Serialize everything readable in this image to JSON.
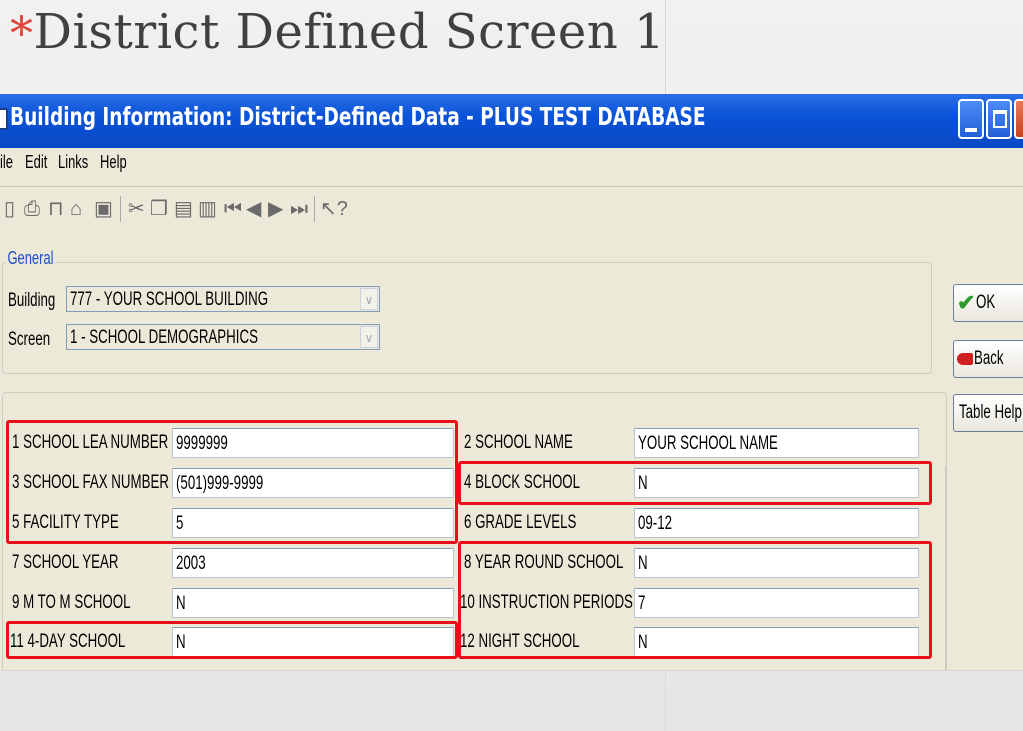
{
  "slide": {
    "bullet": "*",
    "title": "District Defined Screen 1"
  },
  "window": {
    "title": "Building Information: District-Defined Data - PLUS TEST DATABASE"
  },
  "menu": [
    {
      "label": "ile"
    },
    {
      "label": "Edit"
    },
    {
      "label": "Links"
    },
    {
      "label": "Help"
    }
  ],
  "toolbar_icons": [
    "new-icon",
    "print-icon",
    "delete-icon",
    "open-icon",
    "save-icon",
    "cut-icon",
    "copy-icon",
    "paste-icon",
    "clipboard-icon",
    "first-record-icon",
    "prev-record-icon",
    "next-record-icon",
    "last-record-icon",
    "help-pointer-icon"
  ],
  "general": {
    "group_label": "General",
    "building_label": "Building",
    "building_value": "777 - YOUR SCHOOL BUILDING",
    "screen_label": "Screen",
    "screen_value": "1 - SCHOOL DEMOGRAPHICS"
  },
  "buttons": {
    "ok": "OK",
    "back": "Back",
    "table_help": "Table Help"
  },
  "fields": [
    {
      "label": "1  SCHOOL LEA NUMBER",
      "value": "9999999"
    },
    {
      "label": "2  SCHOOL NAME",
      "value": "YOUR SCHOOL NAME"
    },
    {
      "label": "3  SCHOOL FAX NUMBER",
      "value": "(501)999-9999"
    },
    {
      "label": "4  BLOCK SCHOOL",
      "value": "N"
    },
    {
      "label": "5  FACILITY TYPE",
      "value": "5"
    },
    {
      "label": "6  GRADE LEVELS",
      "value": "09-12"
    },
    {
      "label": "7  SCHOOL YEAR",
      "value": "2003"
    },
    {
      "label": "8  YEAR ROUND SCHOOL",
      "value": "N"
    },
    {
      "label": "9  M TO M SCHOOL",
      "value": "N"
    },
    {
      "label": "10 INSTRUCTION PERIODS",
      "value": "7"
    },
    {
      "label": "11 4-DAY SCHOOL",
      "value": "N"
    },
    {
      "label": "12 NIGHT SCHOOL",
      "value": "N"
    }
  ],
  "colors": {
    "titlebar": "#0b52d8",
    "highlight": "#e8101a",
    "group_label": "#1f4fc7"
  }
}
